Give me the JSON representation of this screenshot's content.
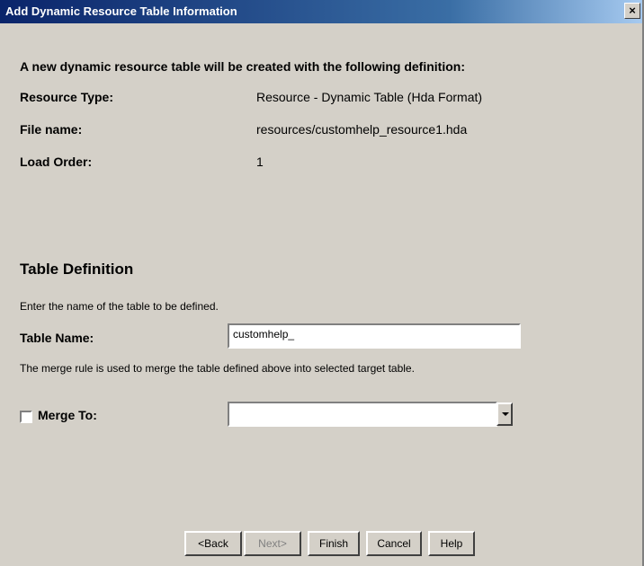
{
  "window": {
    "title": "Add Dynamic Resource Table Information",
    "close_label": "×"
  },
  "summary": {
    "intro": "A new dynamic resource table will be created with the following definition:",
    "resource_type_label": "Resource Type:",
    "resource_type_value": "Resource - Dynamic Table (Hda Format)",
    "file_name_label": "File name:",
    "file_name_value": "resources/customhelp_resource1.hda",
    "load_order_label": "Load Order:",
    "load_order_value": "1"
  },
  "table_definition": {
    "heading": "Table Definition",
    "instruction": "Enter the name of the table to be defined.",
    "table_name_label": "Table Name:",
    "table_name_value": "customhelp_",
    "merge_instruction": "The merge rule is used to merge the table defined above into selected target table.",
    "merge_to_label": "Merge To:",
    "merge_to_checked": false,
    "merge_to_value": ""
  },
  "buttons": {
    "back": "<Back",
    "next": "Next>",
    "finish": "Finish",
    "cancel": "Cancel",
    "help": "Help"
  }
}
